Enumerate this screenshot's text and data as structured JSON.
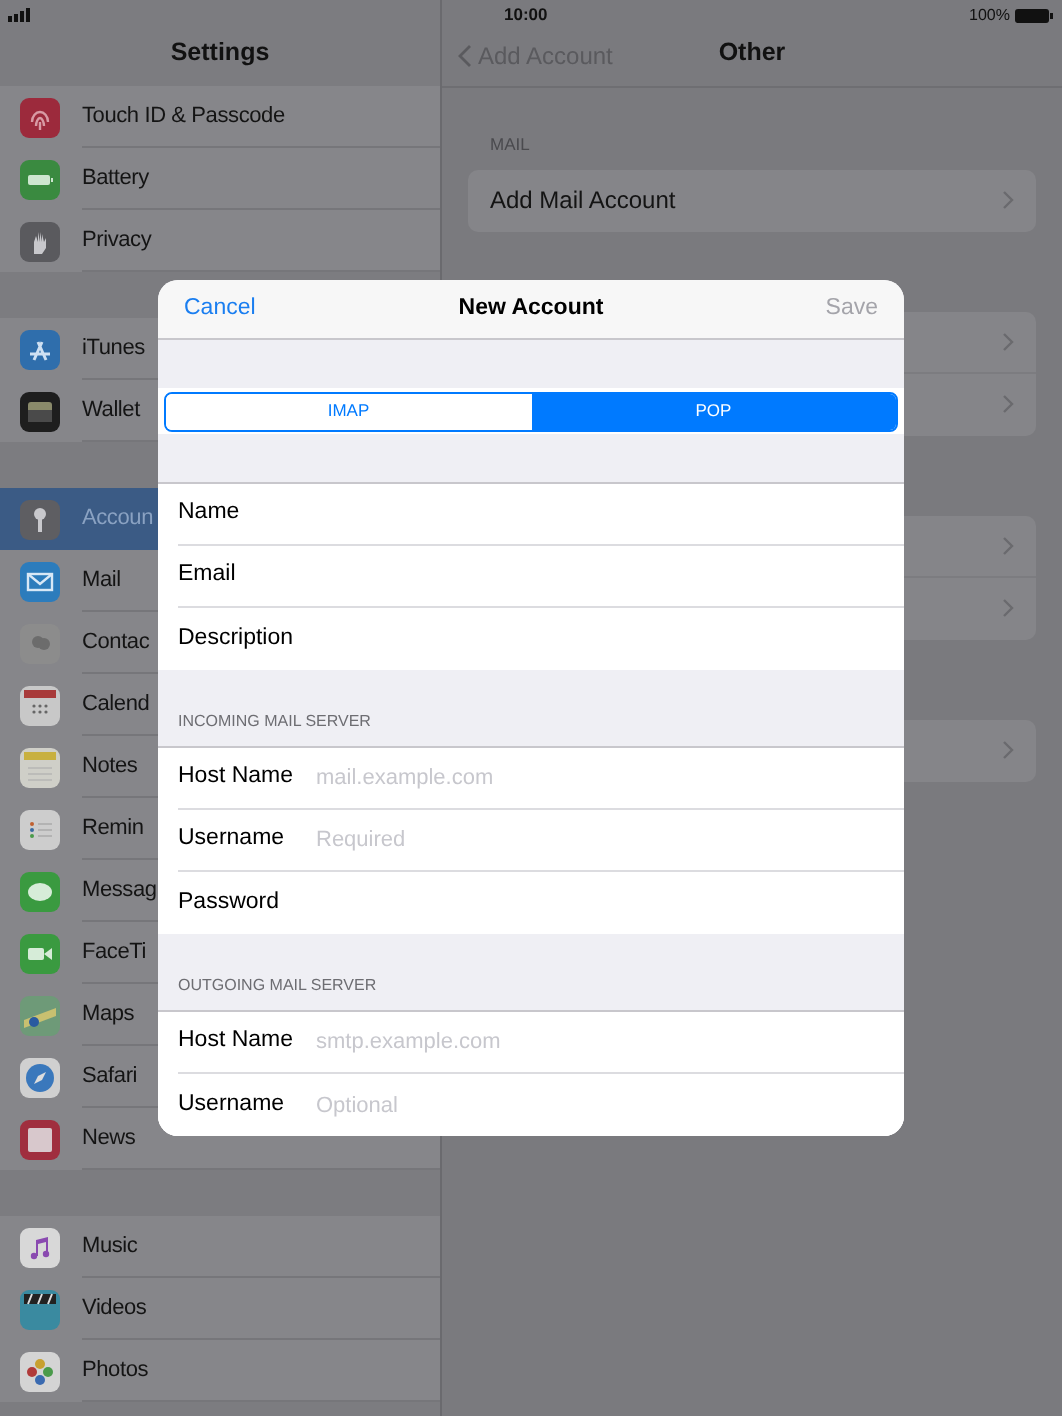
{
  "status_bar": {
    "time": "10:00",
    "battery": "100%"
  },
  "sidebar": {
    "title": "Settings",
    "groups": [
      [
        {
          "label": "Touch ID & Passcode",
          "selected": false
        },
        {
          "label": "Battery",
          "selected": false
        },
        {
          "label": "Privacy",
          "selected": false
        }
      ],
      [
        {
          "label": "iTunes",
          "selected": false
        },
        {
          "label": "Wallet",
          "selected": false
        }
      ],
      [
        {
          "label": "Accoun",
          "selected": true
        },
        {
          "label": "Mail",
          "selected": false
        },
        {
          "label": "Contac",
          "selected": false
        },
        {
          "label": "Calend",
          "selected": false
        },
        {
          "label": "Notes",
          "selected": false
        },
        {
          "label": "Remin",
          "selected": false
        },
        {
          "label": "Messag",
          "selected": false
        },
        {
          "label": "FaceTi",
          "selected": false
        },
        {
          "label": "Maps",
          "selected": false
        },
        {
          "label": "Safari",
          "selected": false
        },
        {
          "label": "News",
          "selected": false
        }
      ],
      [
        {
          "label": "Music",
          "selected": false
        },
        {
          "label": "Videos",
          "selected": false
        },
        {
          "label": "Photos",
          "selected": false
        }
      ]
    ]
  },
  "detail": {
    "back": "Add Account",
    "title": "Other",
    "sections": [
      {
        "header": "MAIL",
        "rows": [
          {
            "label": "Add Mail Account"
          }
        ]
      },
      {
        "rows": [
          {},
          {}
        ]
      },
      {
        "rows": [
          {},
          {}
        ]
      },
      {
        "rows": [
          {}
        ]
      }
    ]
  },
  "dialog": {
    "cancel": "Cancel",
    "title": "New Account",
    "save": "Save",
    "save_disabled": true,
    "segments": [
      {
        "label": "IMAP",
        "selected": false
      },
      {
        "label": "POP",
        "selected": true
      }
    ],
    "sections": [
      {
        "rows": [
          {
            "label": "Name"
          },
          {
            "label": "Email"
          },
          {
            "label": "Description"
          }
        ]
      },
      {
        "header": "INCOMING MAIL SERVER",
        "rows": [
          {
            "label": "Host Name",
            "placeholder": "mail.example.com"
          },
          {
            "label": "Username",
            "placeholder": "Required"
          },
          {
            "label": "Password"
          }
        ]
      },
      {
        "header": "OUTGOING MAIL SERVER",
        "rows": [
          {
            "label": "Host Name",
            "placeholder": "smtp.example.com"
          },
          {
            "label": "Username",
            "placeholder": "Optional"
          }
        ]
      }
    ]
  }
}
